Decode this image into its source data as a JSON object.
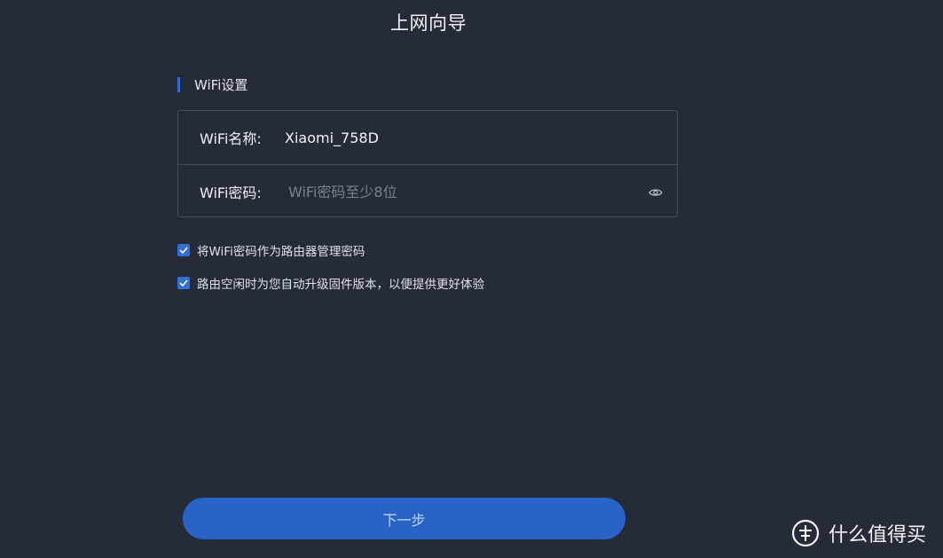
{
  "page": {
    "title": "上网向导"
  },
  "section": {
    "title": "WiFi设置"
  },
  "form": {
    "name_label": "WiFi名称:",
    "name_value": "Xiaomi_758D",
    "password_label": "WiFi密码:",
    "password_value": "",
    "password_placeholder": "WiFi密码至少8位",
    "password_toggle_icon": "eye-icon"
  },
  "options": [
    {
      "label": "将WiFi密码作为路由器管理密码",
      "checked": true
    },
    {
      "label": "路由空闲时为您自动升级固件版本，以便提供更好体验",
      "checked": true
    }
  ],
  "actions": {
    "next_label": "下一步"
  },
  "watermark": {
    "text": "什么值得买",
    "logo_char": "值"
  },
  "colors": {
    "background": "#252b38",
    "accent": "#2f6fd6",
    "button": "#2a63c8",
    "border": "#444b59"
  }
}
